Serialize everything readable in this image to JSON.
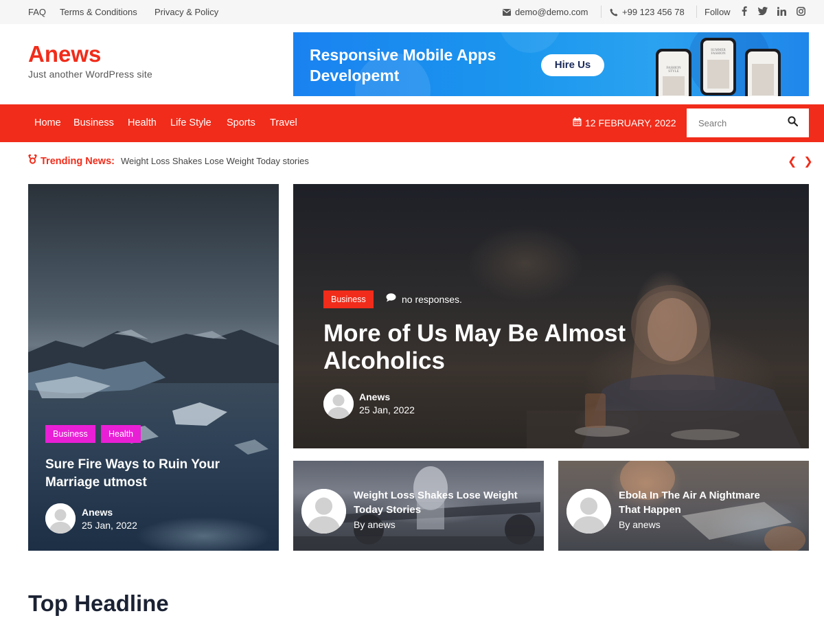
{
  "topbar": {
    "links": [
      "FAQ",
      "Terms & Conditions",
      "Privacy & Policy"
    ],
    "email": "demo@demo.com",
    "phone": "+99 123 456 78",
    "follow_label": "Follow",
    "social_icons": [
      "facebook-icon",
      "twitter-icon",
      "linkedin-icon",
      "instagram-icon"
    ]
  },
  "header": {
    "site_title": "Anews",
    "tagline": "Just another WordPress site"
  },
  "banner": {
    "title_line1": "Responsive Mobile Apps",
    "title_line2": "Developemt",
    "button_label": "Hire Us",
    "phone_screens": [
      {
        "caption_line1": "FASHION",
        "caption_line2": "STYLE"
      },
      {
        "caption_line1": "SUMMER",
        "caption_line2": "FASHION"
      },
      {
        "caption_line1": "",
        "caption_line2": ""
      }
    ]
  },
  "nav": {
    "items": [
      "Home",
      "Business",
      "Health",
      "Life Style",
      "Sports",
      "Travel"
    ],
    "date": "12 FEBRUARY, 2022",
    "search_placeholder": "Search"
  },
  "trending": {
    "label": "Trending News:",
    "text": "Weight Loss Shakes Lose Weight Today stories",
    "prev": "❮",
    "next": "❯"
  },
  "cards": {
    "left": {
      "categories": [
        "Business",
        "Health"
      ],
      "title_line1": "Sure Fire Ways to Ruin Your",
      "title_line2": "Marriage utmost",
      "author": "Anews",
      "date": "25 Jan, 2022"
    },
    "main": {
      "category": "Business",
      "comments": "no responses.",
      "title_line1": "More of Us May Be Almost",
      "title_line2": "Alcoholics",
      "author": "Anews",
      "date": "25 Jan, 2022"
    },
    "small1": {
      "title_line1": "Weight Loss Shakes Lose Weight",
      "title_line2": "Today Stories",
      "byline": "By anews"
    },
    "small2": {
      "title_line1": "Ebola In The Air A Nightmare",
      "title_line2": "That Happen",
      "byline": "By anews"
    }
  },
  "section": {
    "top_headline": "Top Headline"
  },
  "colors": {
    "brand_red": "#f12c1a",
    "badge_magenta": "#e91fd6",
    "banner_blue": "#1b8cf0"
  }
}
